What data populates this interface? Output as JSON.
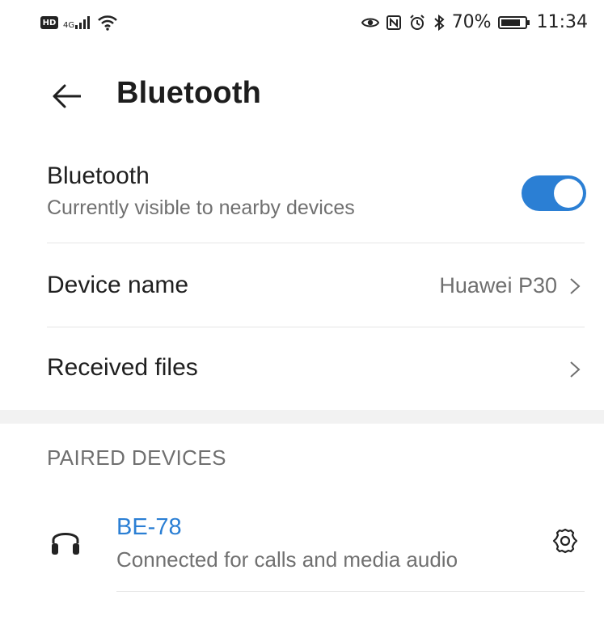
{
  "status_bar": {
    "hd_label": "HD",
    "network_label": "4G",
    "battery_percent": "70%",
    "time": "11:34",
    "icons": [
      "hd-icon",
      "signal-icon",
      "wifi-icon",
      "eye-icon",
      "nfc-icon",
      "alarm-icon",
      "bluetooth-icon",
      "battery-icon"
    ]
  },
  "header": {
    "back_icon": "arrow-left-icon",
    "title": "Bluetooth"
  },
  "settings": {
    "bluetooth": {
      "title": "Bluetooth",
      "subtitle": "Currently visible to nearby devices",
      "enabled": true
    },
    "device_name": {
      "label": "Device name",
      "value": "Huawei P30"
    },
    "received_files": {
      "label": "Received files"
    }
  },
  "paired_devices": {
    "section_label": "PAIRED DEVICES",
    "items": [
      {
        "name": "BE-78",
        "status": "Connected for calls and media audio",
        "icon": "headphones-icon",
        "action_icon": "gear-icon"
      }
    ]
  },
  "colors": {
    "accent": "#2b7fd4",
    "primary_text": "#1f1f1f",
    "secondary_text": "#707070",
    "divider": "#e6e6e6",
    "section_background": "#f2f2f2"
  }
}
